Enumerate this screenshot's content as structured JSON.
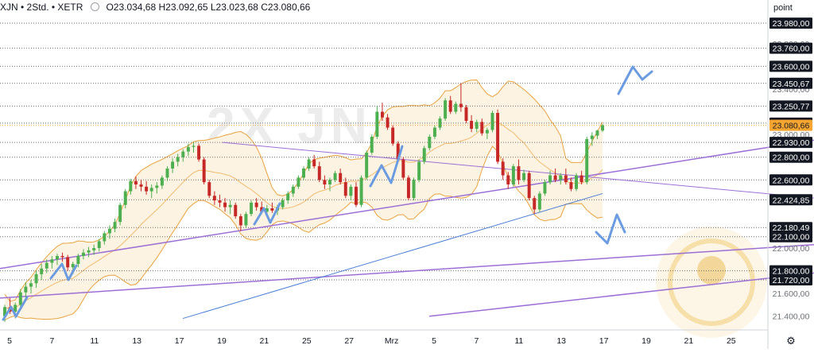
{
  "header": {
    "symbol": "XJN • 2Std. • XETR",
    "ohlc": "O23.034,68 H23.092,65 L23.023,68 C23.080,66"
  },
  "axis_unit": "point",
  "watermark": "2X JN",
  "colors": {
    "bull": "#4caf50",
    "bear": "#c62828",
    "band": "#e8a33d",
    "band_fill": "#fdf3e2",
    "purple": "#9c6fd6",
    "blue": "#4a7fd6",
    "arrow": "#6b9be0",
    "grid": "#6b6b6b",
    "label_bg": "#131722",
    "price_bg": "#f7a531"
  },
  "chart_data": {
    "type": "candlestick",
    "symbol": "XJN",
    "interval": "2Std.",
    "exchange": "XETR",
    "last": {
      "open": 23034.68,
      "high": 23092.65,
      "low": 23023.68,
      "close": 23080.66
    },
    "current_price": 23080.66,
    "ylim": [
      21300,
      24030
    ],
    "y_ticks": [
      22000,
      21600,
      21400,
      23800,
      23400,
      23000
    ],
    "x_ticks": [
      "5",
      "7",
      "11",
      "13",
      "17",
      "19",
      "21",
      "25",
      "27",
      "Mrz",
      "5",
      "7",
      "11",
      "13",
      "17",
      "19",
      "21",
      "25"
    ],
    "x_tick_positions": [
      0,
      4,
      8,
      12,
      16,
      20,
      24,
      28,
      32,
      36,
      40,
      44,
      48,
      52,
      56,
      60,
      64,
      68
    ],
    "horizontal_levels": [
      23980,
      23760,
      23600,
      23450.67,
      23250.77,
      23100,
      22930,
      22800,
      22600,
      22424.85,
      22180.49,
      22100,
      21800,
      21720
    ],
    "grid": false,
    "candles": [
      [
        21400,
        21500,
        21350,
        21480
      ],
      [
        21480,
        21560,
        21420,
        21440
      ],
      [
        21440,
        21520,
        21380,
        21500
      ],
      [
        21500,
        21640,
        21470,
        21610
      ],
      [
        21610,
        21700,
        21560,
        21660
      ],
      [
        21660,
        21720,
        21600,
        21690
      ],
      [
        21690,
        21800,
        21650,
        21770
      ],
      [
        21770,
        21860,
        21720,
        21820
      ],
      [
        21820,
        21900,
        21780,
        21870
      ],
      [
        21870,
        21930,
        21820,
        21900
      ],
      [
        21900,
        21950,
        21850,
        21930
      ],
      [
        21930,
        21960,
        21880,
        21920
      ],
      [
        21920,
        21940,
        21800,
        21830
      ],
      [
        21830,
        21880,
        21770,
        21860
      ],
      [
        21860,
        21950,
        21830,
        21930
      ],
      [
        21930,
        21990,
        21900,
        21960
      ],
      [
        21960,
        22010,
        21920,
        21980
      ],
      [
        21980,
        22030,
        21940,
        22000
      ],
      [
        22000,
        22080,
        21970,
        22060
      ],
      [
        22060,
        22150,
        22030,
        22130
      ],
      [
        22130,
        22200,
        22080,
        22170
      ],
      [
        22170,
        22260,
        22140,
        22230
      ],
      [
        22230,
        22400,
        22200,
        22380
      ],
      [
        22380,
        22520,
        22350,
        22500
      ],
      [
        22500,
        22610,
        22470,
        22590
      ],
      [
        22590,
        22630,
        22520,
        22560
      ],
      [
        22560,
        22600,
        22500,
        22540
      ],
      [
        22540,
        22590,
        22470,
        22500
      ],
      [
        22500,
        22560,
        22440,
        22530
      ],
      [
        22530,
        22580,
        22480,
        22550
      ],
      [
        22550,
        22640,
        22520,
        22620
      ],
      [
        22620,
        22720,
        22590,
        22700
      ],
      [
        22700,
        22790,
        22660,
        22760
      ],
      [
        22760,
        22830,
        22720,
        22800
      ],
      [
        22800,
        22870,
        22760,
        22850
      ],
      [
        22850,
        22920,
        22810,
        22890
      ],
      [
        22890,
        22930,
        22840,
        22900
      ],
      [
        22900,
        22920,
        22760,
        22780
      ],
      [
        22780,
        22800,
        22560,
        22580
      ],
      [
        22580,
        22600,
        22440,
        22460
      ],
      [
        22460,
        22500,
        22380,
        22420
      ],
      [
        22420,
        22470,
        22360,
        22400
      ],
      [
        22400,
        22440,
        22320,
        22360
      ],
      [
        22360,
        22420,
        22300,
        22380
      ],
      [
        22380,
        22400,
        22260,
        22280
      ],
      [
        22280,
        22300,
        22150,
        22200
      ],
      [
        22200,
        22320,
        22180,
        22300
      ],
      [
        22300,
        22420,
        22280,
        22400
      ],
      [
        22400,
        22440,
        22330,
        22360
      ],
      [
        22360,
        22410,
        22300,
        22320
      ],
      [
        22320,
        22380,
        22290,
        22350
      ],
      [
        22350,
        22400,
        22310,
        22330
      ],
      [
        22330,
        22380,
        22290,
        22360
      ],
      [
        22360,
        22440,
        22340,
        22420
      ],
      [
        22420,
        22500,
        22390,
        22480
      ],
      [
        22480,
        22560,
        22450,
        22540
      ],
      [
        22540,
        22640,
        22520,
        22620
      ],
      [
        22620,
        22720,
        22600,
        22700
      ],
      [
        22700,
        22800,
        22680,
        22780
      ],
      [
        22780,
        22820,
        22700,
        22720
      ],
      [
        22720,
        22760,
        22580,
        22600
      ],
      [
        22600,
        22640,
        22520,
        22560
      ],
      [
        22560,
        22620,
        22500,
        22600
      ],
      [
        22600,
        22680,
        22580,
        22660
      ],
      [
        22660,
        22700,
        22560,
        22580
      ],
      [
        22580,
        22620,
        22440,
        22460
      ],
      [
        22460,
        22560,
        22420,
        22540
      ],
      [
        22540,
        22580,
        22360,
        22380
      ],
      [
        22380,
        22640,
        22360,
        22620
      ],
      [
        22620,
        22860,
        22600,
        22840
      ],
      [
        22840,
        23000,
        22820,
        22980
      ],
      [
        22980,
        23250,
        22960,
        23200
      ],
      [
        23200,
        23280,
        23120,
        23150
      ],
      [
        23150,
        23180,
        23040,
        23060
      ],
      [
        23060,
        23080,
        22900,
        22920
      ],
      [
        22920,
        22940,
        22760,
        22780
      ],
      [
        22780,
        22800,
        22600,
        22620
      ],
      [
        22620,
        22640,
        22420,
        22440
      ],
      [
        22440,
        22620,
        22420,
        22600
      ],
      [
        22600,
        22780,
        22580,
        22760
      ],
      [
        22760,
        22900,
        22740,
        22880
      ],
      [
        22880,
        23000,
        22860,
        22980
      ],
      [
        22980,
        23080,
        22960,
        23060
      ],
      [
        23060,
        23160,
        23040,
        23140
      ],
      [
        23140,
        23320,
        23120,
        23300
      ],
      [
        23300,
        23340,
        23180,
        23200
      ],
      [
        23200,
        23290,
        23180,
        23270
      ],
      [
        23270,
        23450,
        23200,
        23240
      ],
      [
        23240,
        23260,
        23100,
        23120
      ],
      [
        23120,
        23170,
        23020,
        23050
      ],
      [
        23050,
        23130,
        23020,
        23110
      ],
      [
        23110,
        23140,
        22990,
        23010
      ],
      [
        23010,
        23060,
        22960,
        23040
      ],
      [
        23040,
        23210,
        23020,
        23190
      ],
      [
        23190,
        23220,
        22740,
        22760
      ],
      [
        22760,
        22790,
        22600,
        22640
      ],
      [
        22640,
        22670,
        22520,
        22560
      ],
      [
        22560,
        22740,
        22540,
        22720
      ],
      [
        22720,
        22780,
        22560,
        22600
      ],
      [
        22600,
        22690,
        22580,
        22660
      ],
      [
        22660,
        22680,
        22420,
        22440
      ],
      [
        22440,
        22460,
        22300,
        22340
      ],
      [
        22340,
        22500,
        22320,
        22480
      ],
      [
        22480,
        22600,
        22460,
        22580
      ],
      [
        22580,
        22680,
        22560,
        22640
      ],
      [
        22640,
        22700,
        22580,
        22600
      ],
      [
        22600,
        22660,
        22560,
        22640
      ],
      [
        22640,
        22700,
        22560,
        22580
      ],
      [
        22580,
        22620,
        22500,
        22520
      ],
      [
        22520,
        22660,
        22500,
        22640
      ],
      [
        22640,
        22680,
        22560,
        22580
      ],
      [
        22580,
        22980,
        22560,
        22960
      ],
      [
        22960,
        23020,
        22900,
        22990
      ],
      [
        22990,
        23040,
        22960,
        23034.68
      ],
      [
        23034.68,
        23092.65,
        23023.68,
        23080.66
      ]
    ]
  }
}
